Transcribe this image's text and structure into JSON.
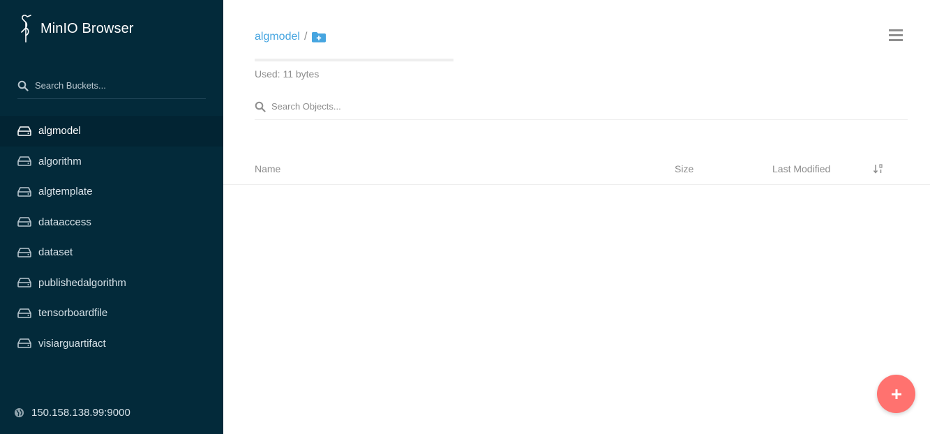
{
  "app": {
    "title": "MinIO Browser"
  },
  "sidebar": {
    "search": {
      "placeholder": "Search Buckets..."
    },
    "buckets": [
      {
        "label": "algmodel",
        "active": true
      },
      {
        "label": "algorithm",
        "active": false
      },
      {
        "label": "algtemplate",
        "active": false
      },
      {
        "label": "dataaccess",
        "active": false
      },
      {
        "label": "dataset",
        "active": false
      },
      {
        "label": "publishedalgorithm",
        "active": false
      },
      {
        "label": "tensorboardfile",
        "active": false
      },
      {
        "label": "visiarguartifact",
        "active": false
      }
    ],
    "host": "150.158.138.99:9000"
  },
  "main": {
    "breadcrumb": {
      "bucket": "algmodel",
      "separator": "/"
    },
    "usage": {
      "text": "Used: 11 bytes",
      "fraction": 0
    },
    "search": {
      "placeholder": "Search Objects..."
    },
    "table": {
      "headers": {
        "name": "Name",
        "size": "Size",
        "last_modified": "Last Modified"
      },
      "rows": []
    }
  },
  "icons": {
    "logo": "minio-bird-icon",
    "search": "search-icon",
    "bucket": "drive-icon",
    "globe": "globe-icon",
    "add_folder": "folder-plus-icon",
    "menu": "hamburger-menu-icon",
    "sort": "sort-icon",
    "add": "plus-icon"
  },
  "colors": {
    "sidebar_bg": "#032a3a",
    "sidebar_active": "#022433",
    "accent": "#46a5e0",
    "fab": "#ff726f",
    "muted_text": "#8e8e8e"
  }
}
